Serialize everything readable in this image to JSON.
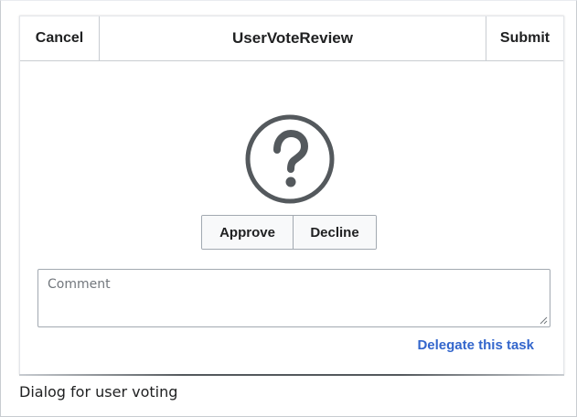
{
  "dialog": {
    "title": "UserVoteReview",
    "cancel_label": "Cancel",
    "submit_label": "Submit",
    "status_icon": "question-circle-icon",
    "vote": {
      "approve_label": "Approve",
      "decline_label": "Decline"
    },
    "comment": {
      "value": "",
      "placeholder": "Comment"
    },
    "delegate_label": "Delegate this task"
  },
  "caption": "Dialog for user voting",
  "colors": {
    "link": "#3366cc",
    "border": "#a2a9b1",
    "icon": "#54595d",
    "text": "#202122"
  }
}
